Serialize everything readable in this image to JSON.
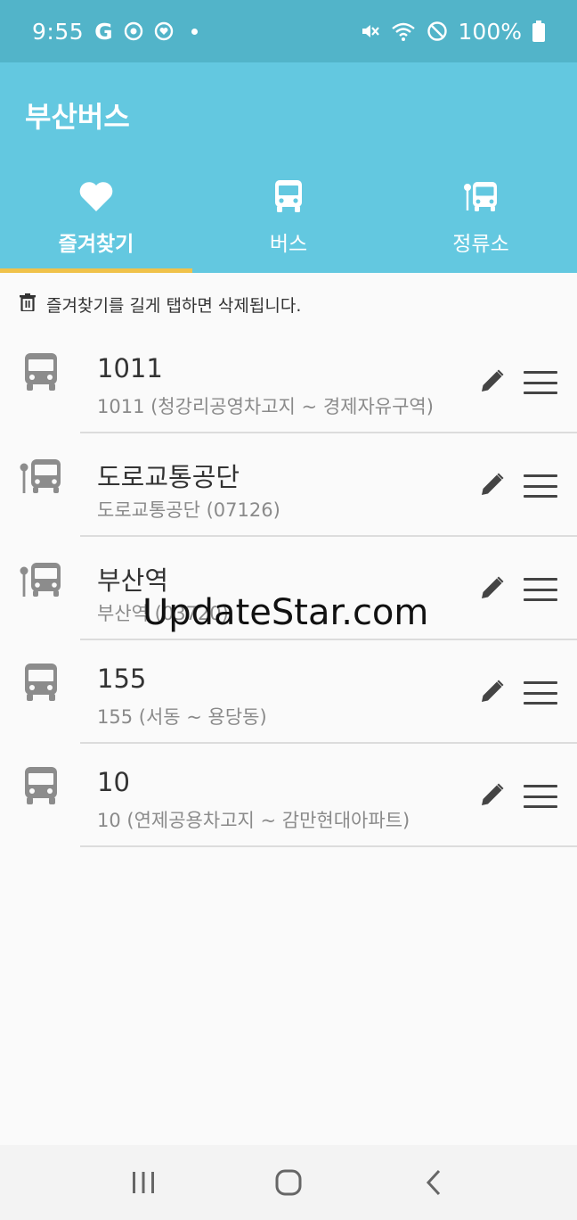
{
  "status_bar": {
    "time": "9:55",
    "g_label": "G",
    "battery": "100%"
  },
  "app": {
    "title": "부산버스"
  },
  "tabs": [
    {
      "label": "즐겨찾기",
      "icon": "heart-icon",
      "active": true
    },
    {
      "label": "버스",
      "icon": "bus-icon",
      "active": false
    },
    {
      "label": "정류소",
      "icon": "bus-stop-icon",
      "active": false
    }
  ],
  "hint": {
    "text": "즐겨찾기를 길게 탭하면 삭제됩니다."
  },
  "favorites": [
    {
      "type": "bus",
      "title": "1011",
      "subtitle": "1011 (청강리공영차고지 ~ 경제자유구역)"
    },
    {
      "type": "stop",
      "title": "도로교통공단",
      "subtitle": "도로교통공단 (07126)"
    },
    {
      "type": "stop",
      "title": "부산역",
      "subtitle": "부산역 (03720)"
    },
    {
      "type": "bus",
      "title": "155",
      "subtitle": "155 (서동 ~ 용당동)"
    },
    {
      "type": "bus",
      "title": "10",
      "subtitle": "10 (연제공용차고지 ~ 감만현대아파트)"
    }
  ],
  "watermark": "UpdateStar.com",
  "colors": {
    "status_bar": "#52b4c9",
    "app_bar": "#63c8e0",
    "tab_indicator": "#f0c24a",
    "icon_gray": "#8c8c8c"
  }
}
